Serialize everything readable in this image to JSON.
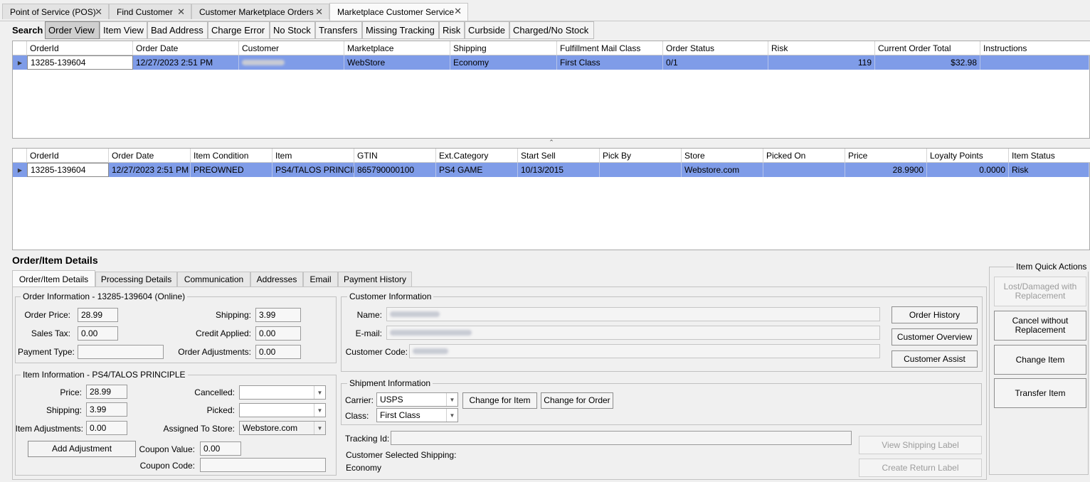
{
  "doc_tabs": [
    "Point of Service (POS)",
    "Find Customer",
    "Customer Marketplace Orders",
    "Marketplace Customer Service"
  ],
  "toolbar": {
    "search_label": "Search",
    "buttons": [
      "Order View",
      "Item View",
      "Bad Address",
      "Charge Error",
      "No Stock",
      "Transfers",
      "Missing Tracking",
      "Risk",
      "Curbside",
      "Charged/No Stock"
    ]
  },
  "orders_grid": {
    "headers": [
      "OrderId",
      "Order Date",
      "Customer",
      "Marketplace",
      "Shipping",
      "Fulfillment Mail Class",
      "Order Status",
      "Risk",
      "Current Order Total",
      "Instructions"
    ],
    "row": [
      "13285-139604",
      "12/27/2023 2:51 PM",
      "",
      "WebStore",
      "Economy",
      "First Class",
      "0/1",
      "119",
      "$32.98",
      ""
    ]
  },
  "items_grid": {
    "headers": [
      "OrderId",
      "Order Date",
      "Item Condition",
      "Item",
      "GTIN",
      "Ext.Category",
      "Start Sell",
      "Pick By",
      "Store",
      "Picked On",
      "Price",
      "Loyalty Points",
      "Item Status"
    ],
    "row": [
      "13285-139604",
      "12/27/2023 2:51 PM",
      "PREOWNED",
      "PS4/TALOS PRINCIP...",
      "865790000100",
      "PS4 GAME",
      "10/13/2015",
      "",
      "Webstore.com",
      "",
      "28.9900",
      "0.0000",
      "Risk"
    ]
  },
  "details": {
    "title": "Order/Item Details",
    "tabs": [
      "Order/Item Details",
      "Processing Details",
      "Communication",
      "Addresses",
      "Email",
      "Payment History"
    ],
    "order_info": {
      "title": "Order Information - 13285-139604 (Online)",
      "order_price_label": "Order Price:",
      "order_price": "28.99",
      "sales_tax_label": "Sales Tax:",
      "sales_tax": "0.00",
      "payment_type_label": "Payment Type:",
      "payment_type": "",
      "shipping_label": "Shipping:",
      "shipping": "3.99",
      "credit_applied_label": "Credit Applied:",
      "credit_applied": "0.00",
      "order_adjustments_label": "Order Adjustments:",
      "order_adjustments": "0.00"
    },
    "item_info": {
      "title": "Item Information - PS4/TALOS PRINCIPLE",
      "price_label": "Price:",
      "price": "28.99",
      "shipping_label": "Shipping:",
      "shipping": "3.99",
      "item_adjustments_label": "Item Adjustments:",
      "item_adjustments": "0.00",
      "add_adjustment": "Add Adjustment",
      "cancelled_label": "Cancelled:",
      "cancelled": "",
      "picked_label": "Picked:",
      "picked": "",
      "assigned_store_label": "Assigned To Store:",
      "assigned_store": "Webstore.com",
      "coupon_value_label": "Coupon Value:",
      "coupon_value": "0.00",
      "coupon_code_label": "Coupon Code:",
      "coupon_code": ""
    },
    "customer_info": {
      "title": "Customer Information",
      "name_label": "Name:",
      "email_label": "E-mail:",
      "code_label": "Customer Code:",
      "order_history": "Order History",
      "customer_overview": "Customer Overview",
      "customer_assist": "Customer Assist"
    },
    "shipment_info": {
      "title": "Shipment Information",
      "carrier_label": "Carrier:",
      "carrier": "USPS",
      "class_label": "Class:",
      "class": "First Class",
      "change_for_item": "Change for Item",
      "change_for_order": "Change for Order",
      "tracking_label": "Tracking Id:",
      "tracking": "",
      "selected_shipping_label": "Customer Selected Shipping:",
      "selected_shipping": "Economy",
      "view_label": "View Shipping Label",
      "return_label": "Create Return Label"
    },
    "quick_actions": {
      "title": "Item Quick Actions",
      "lost_damaged": "Lost/Damaged with Replacement",
      "cancel_without": "Cancel without Replacement",
      "change_item": "Change Item",
      "transfer_item": "Transfer Item"
    }
  }
}
